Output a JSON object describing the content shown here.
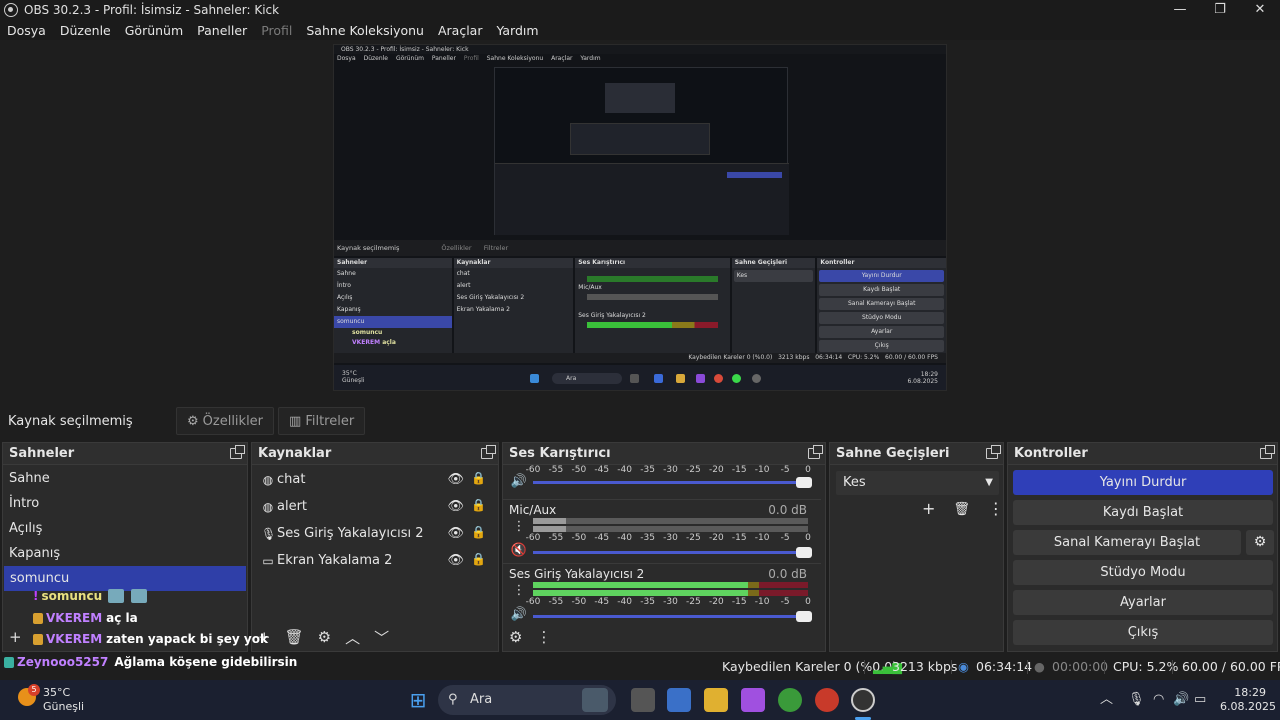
{
  "window": {
    "title": "OBS 30.2.3 - Profil: İsimsiz - Sahneler: Kick",
    "controls": [
      "—",
      "❐",
      "✕"
    ]
  },
  "menu": [
    "Dosya",
    "Düzenle",
    "Görünüm",
    "Paneller",
    "Profil",
    "Sahne Koleksiyonu",
    "Araçlar",
    "Yardım"
  ],
  "nested": {
    "title": "OBS 30.2.3 - Profil: İsimsiz - Sahneler: Kick",
    "menu": [
      "Dosya",
      "Düzenle",
      "Görünüm",
      "Paneller",
      "Profil",
      "Sahne Koleksiyonu",
      "Araçlar",
      "Yardım"
    ],
    "status_text": "Kaynak seçilmemiş",
    "props": "Özellikler",
    "filters": "Filtreler",
    "panel_scenes": "Sahneler",
    "panel_sources": "Kaynaklar",
    "panel_mixer": "Ses Karıştırıcı",
    "panel_trans": "Sahne Geçişleri",
    "panel_ctrl": "Kontroller",
    "scenes": [
      "Sahne",
      "İntro",
      "Açılış",
      "Kapanış",
      "somuncu"
    ],
    "sources": [
      "chat",
      "alert",
      "Ses Giriş Yakalayıcısı 2",
      "Ekran Yakalama 2"
    ],
    "trans_value": "Kes",
    "controls": [
      "Yayını Durdur",
      "Kaydı Başlat",
      "Sanal Kamerayı Başlat",
      "Stüdyo Modu",
      "Ayarlar",
      "Çıkış"
    ],
    "chat": [
      "somuncu",
      "VKEREM",
      "açla",
      "VKEREM",
      "zaten yapack bi şey yok",
      "Zeynooo5257",
      "Ağlama köşene gidebilirsin"
    ],
    "mixer_micaux": "Mic/Aux",
    "mixer_ses": "Ses Giriş Yakalayıcısı 2",
    "mixer_db": "0.0 dB",
    "search": "Ara",
    "weather_temp": "35°C",
    "weather_desc": "Güneşli",
    "time": "18:29",
    "date": "6.08.2025",
    "status_dropped": "Kaybedilen Kareler 0 (%0.0)",
    "status_kbps": "3213 kbps",
    "status_time": "06:34:14",
    "status_cpu": "CPU: 5.2%",
    "status_fps": "60.00 / 60.00 FPS"
  },
  "source_toolbar": {
    "label": "Kaynak seçilmemiş",
    "properties": "Özellikler",
    "filters": "Filtreler"
  },
  "scenes": {
    "title": "Sahneler",
    "items": [
      "Sahne",
      "İntro",
      "Açılış",
      "Kapanış",
      "somuncu"
    ],
    "selected_index": 4
  },
  "chat": {
    "line1_user": "somuncu",
    "line2_user": "VKEREM",
    "line2_msg": "aç la",
    "line3_user": "VKEREM",
    "line3_msg": "zaten yapack bi şey yok",
    "line4_user": "Zeynooo5257",
    "line4_msg": "Ağlama köşene gidebilirsin"
  },
  "sources": {
    "title": "Kaynaklar",
    "items": [
      {
        "name": "chat",
        "icon": "browser-icon"
      },
      {
        "name": "alert",
        "icon": "browser-icon"
      },
      {
        "name": "Ses Giriş Yakalayıcısı 2",
        "icon": "microphone-icon"
      },
      {
        "name": "Ekran Yakalama 2",
        "icon": "monitor-icon"
      }
    ]
  },
  "mixer": {
    "title": "Ses Karıştırıcı",
    "ticks": [
      "-60",
      "-55",
      "-50",
      "-45",
      "-40",
      "-35",
      "-30",
      "-25",
      "-20",
      "-15",
      "-10",
      "-5",
      "0"
    ],
    "channels": [
      {
        "name": "Mic/Aux",
        "db": "0.0 dB",
        "muted": true,
        "level": 0.12
      },
      {
        "name": "Ses Giriş Yakalayıcısı 2",
        "db": "0.0 dB",
        "muted": false,
        "level": 0.78
      }
    ]
  },
  "transitions": {
    "title": "Sahne Geçişleri",
    "selected": "Kes"
  },
  "controls": {
    "title": "Kontroller",
    "stream": "Yayını Durdur",
    "record": "Kaydı Başlat",
    "virtualcam": "Sanal Kamerayı Başlat",
    "studio": "Stüdyo Modu",
    "settings": "Ayarlar",
    "exit": "Çıkış"
  },
  "status": {
    "dropped": "Kaybedilen Kareler 0 (%0.0)",
    "kbps": "3213 kbps",
    "live_time": "06:34:14",
    "rec_time": "00:00:00",
    "cpu": "CPU: 5.2%",
    "fps": "60.00 / 60.00 FPS"
  },
  "taskbar": {
    "weather_badge": "5",
    "temp": "35°C",
    "weather": "Güneşli",
    "search": "Ara",
    "time": "18:29",
    "date": "6.08.2025"
  },
  "colors": {
    "accent": "#2f3fb8",
    "background": "#1e1e1e",
    "panel": "#2b2b2b"
  }
}
